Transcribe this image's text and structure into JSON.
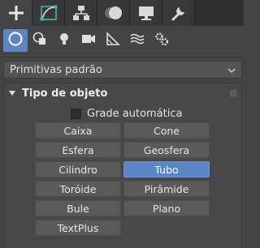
{
  "tabs": [
    {
      "id": "create",
      "icon": "plus-icon",
      "active": true
    },
    {
      "id": "modify",
      "icon": "modify-curve-icon",
      "active": false
    },
    {
      "id": "hierarchy",
      "icon": "hierarchy-icon",
      "active": false
    },
    {
      "id": "motion",
      "icon": "motion-icon",
      "active": false
    },
    {
      "id": "display",
      "icon": "display-monitor-icon",
      "active": false
    },
    {
      "id": "utilities",
      "icon": "wrench-icon",
      "active": false
    }
  ],
  "categories": [
    {
      "icon": "geometry-sphere-icon",
      "active": true
    },
    {
      "icon": "shapes-icon",
      "active": false
    },
    {
      "icon": "lights-icon",
      "active": false
    },
    {
      "icon": "cameras-icon",
      "active": false
    },
    {
      "icon": "helpers-icon",
      "active": false
    },
    {
      "icon": "space-warps-icon",
      "active": false
    },
    {
      "icon": "systems-icon",
      "active": false
    }
  ],
  "dropdown": {
    "selected": "Primitivas padrão"
  },
  "rollout": {
    "title": "Tipo de objeto",
    "autogrid_label": "Grade automática",
    "autogrid_checked": false,
    "buttons": [
      {
        "label": "Caixa",
        "selected": false
      },
      {
        "label": "Cone",
        "selected": false
      },
      {
        "label": "Esfera",
        "selected": false
      },
      {
        "label": "Geosfera",
        "selected": false
      },
      {
        "label": "Cilindro",
        "selected": false
      },
      {
        "label": "Tubo",
        "selected": true
      },
      {
        "label": "Toróide",
        "selected": false
      },
      {
        "label": "Pirâmide",
        "selected": false
      },
      {
        "label": "Bule",
        "selected": false
      },
      {
        "label": "Plano",
        "selected": false
      },
      {
        "label": "TextPlus",
        "selected": false
      }
    ]
  },
  "colors": {
    "accent": "#5b86c4",
    "modify_accent": "#3fb7ac",
    "panel": "#444444"
  }
}
